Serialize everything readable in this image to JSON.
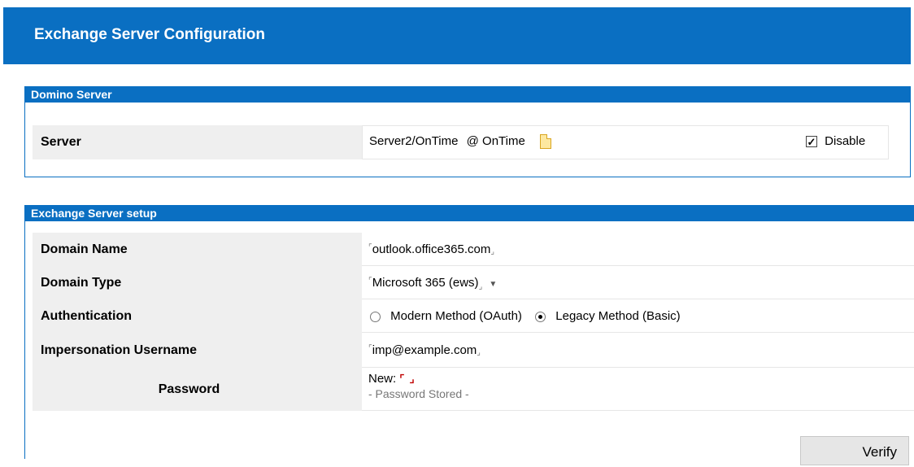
{
  "header": {
    "title": "Exchange Server Configuration"
  },
  "domino": {
    "section_title": "Domino Server",
    "server_label": "Server",
    "server_value": "Server2/OnTime",
    "server_at": "@ OnTime",
    "disable_label": "Disable",
    "disable_checked": true
  },
  "exchange": {
    "section_title": "Exchange Server setup",
    "domain_name_label": "Domain Name",
    "domain_name_value": "outlook.office365.com",
    "domain_type_label": "Domain Type",
    "domain_type_value": "Microsoft 365 (ews)",
    "authentication_label": "Authentication",
    "auth_options": [
      "Modern Method (OAuth)",
      "Legacy Method (Basic)"
    ],
    "auth_selected": "Legacy Method (Basic)",
    "impersonation_label": "Impersonation Username",
    "impersonation_value": "imp@example.com",
    "password_label": "Password",
    "password_new_label": "New:",
    "password_stored_text": "- Password Stored -",
    "verify_label": "Verify"
  },
  "colors": {
    "header_blue": "#0a6fc2",
    "label_bg": "#efefef"
  },
  "icons": {
    "server_picker": "document-icon",
    "field_markers": "corner-bracket-marks"
  }
}
